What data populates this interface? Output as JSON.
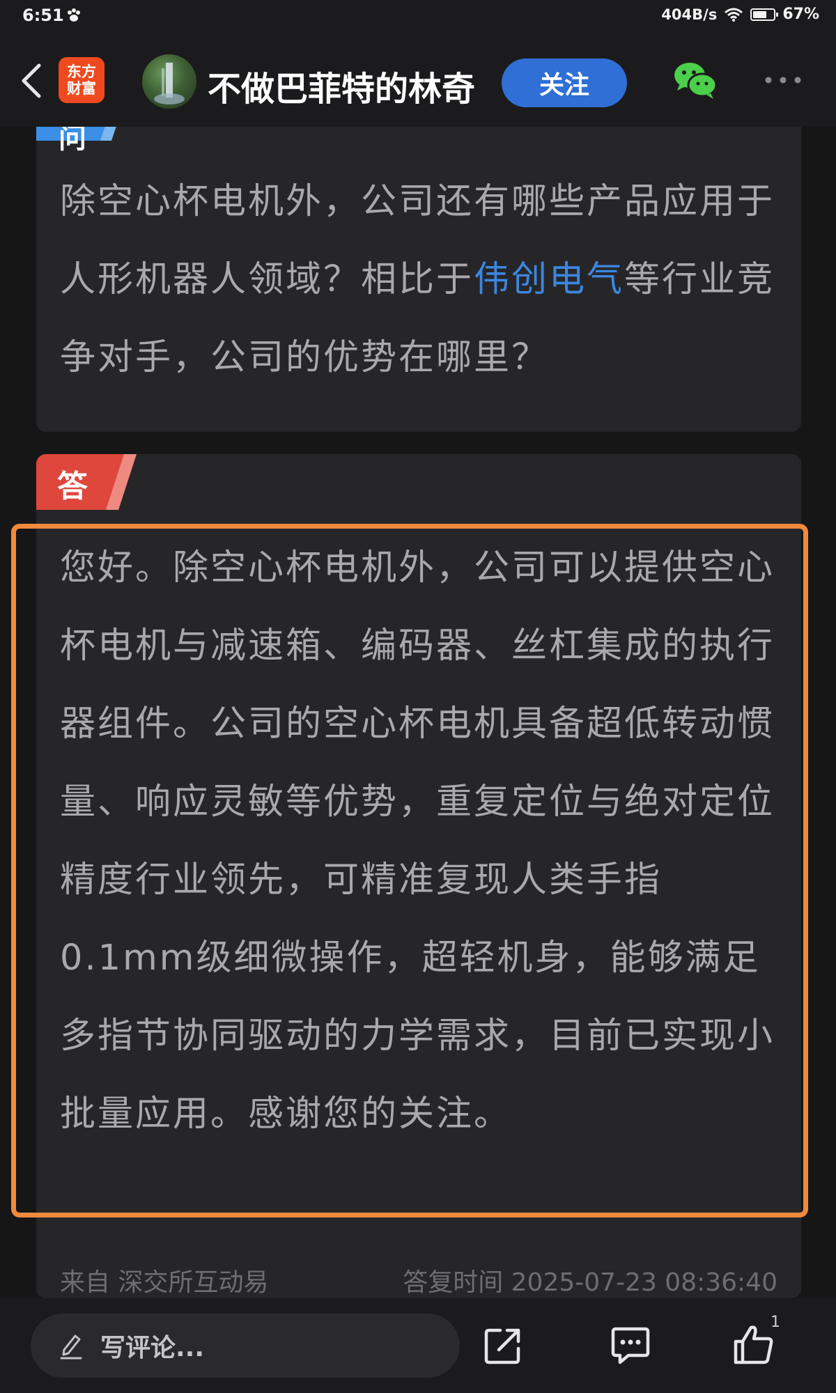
{
  "status_bar": {
    "time": "6:51",
    "network_speed": "404B/s",
    "battery": "67%",
    "battery_level": 0.67
  },
  "header": {
    "app_logo_line1": "东方",
    "app_logo_line2": "财富",
    "username": "不做巴菲特的林奇",
    "follow_label": "关注"
  },
  "question": {
    "tag": "问",
    "text_before": "除空心杯电机外，公司还有哪些产品应用于人形机器人领域？相比于",
    "link": "伟创电气",
    "text_after": "等行业竞争对手，公司的优势在哪里？"
  },
  "answer": {
    "tag": "答",
    "text": "您好。除空心杯电机外，公司可以提供空心杯电机与减速箱、编码器、丝杠集成的执行器组件。公司的空心杯电机具备超低转动惯量、响应灵敏等优势，重复定位与绝对定位精度行业领先，可精准复现人类手指0.1mm级细微操作，超轻机身，能够满足多指节协同驱动的力学需求，目前已实现小批量应用。感谢您的关注。"
  },
  "meta": {
    "source": "来自 深交所互动易",
    "reply_time": "答复时间 2025-07-23 08:36:40"
  },
  "bottom_bar": {
    "comment_placeholder": "写评论...",
    "like_count": "1"
  },
  "colors": {
    "follow_button": "#2f6fd6",
    "link": "#3d86df",
    "question_tag": "#3b8fe6",
    "answer_tag": "#e0473c",
    "highlight_border": "#f08a3c",
    "app_logo": "#ef4a1f",
    "wechat": "#4ccf4a"
  },
  "icons": {
    "back": "chevron-left-icon",
    "wechat": "wechat-icon",
    "more": "more-dots-icon",
    "pencil": "pencil-icon",
    "share": "share-icon",
    "comment": "comment-bubble-icon",
    "like": "thumbs-up-icon"
  }
}
